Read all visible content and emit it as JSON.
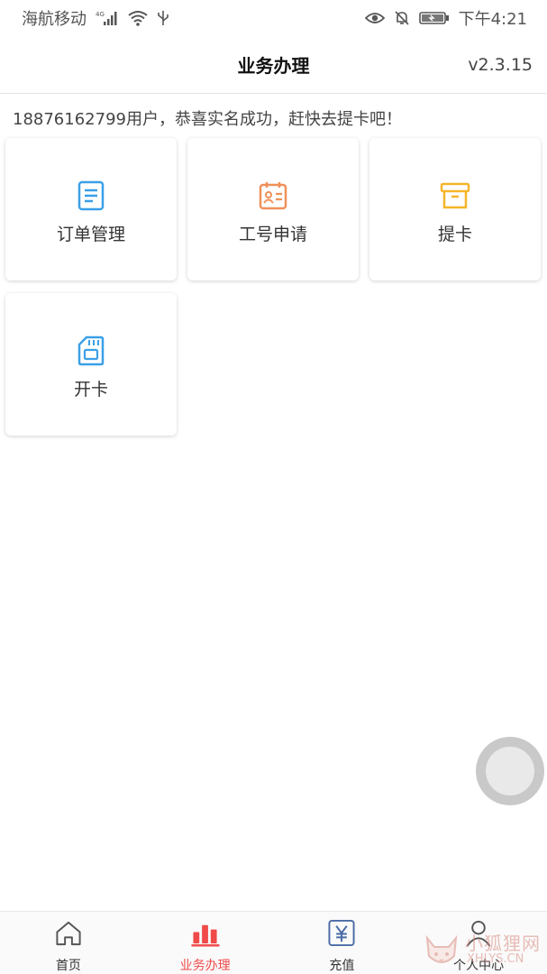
{
  "status_bar": {
    "carrier": "海航移动",
    "network": "4G",
    "time": "下午4:21"
  },
  "header": {
    "title": "业务办理",
    "version": "v2.3.15"
  },
  "notice": "18876162799用户，恭喜实名成功，赶快去提卡吧！",
  "tiles": [
    {
      "label": "订单管理",
      "icon": "document-icon",
      "color": "#3aa0e8"
    },
    {
      "label": "工号申请",
      "icon": "id-card-icon",
      "color": "#f0915a"
    },
    {
      "label": "提卡",
      "icon": "archive-box-icon",
      "color": "#f5b52a"
    },
    {
      "label": "开卡",
      "icon": "sim-card-icon",
      "color": "#3aa0e8"
    }
  ],
  "bottom_nav": [
    {
      "label": "首页",
      "icon": "home-icon",
      "active": false
    },
    {
      "label": "业务办理",
      "icon": "bar-chart-icon",
      "active": true
    },
    {
      "label": "充值",
      "icon": "yen-icon",
      "active": false
    },
    {
      "label": "个人中心",
      "icon": "person-icon",
      "active": false
    }
  ],
  "watermark": {
    "text": "小狐狸网",
    "domain": "XHLYS.CN"
  },
  "colors": {
    "accent": "#f04a4a",
    "blue_icon": "#3aa0e8",
    "orange_icon": "#f0915a",
    "yellow_icon": "#f5b52a"
  }
}
